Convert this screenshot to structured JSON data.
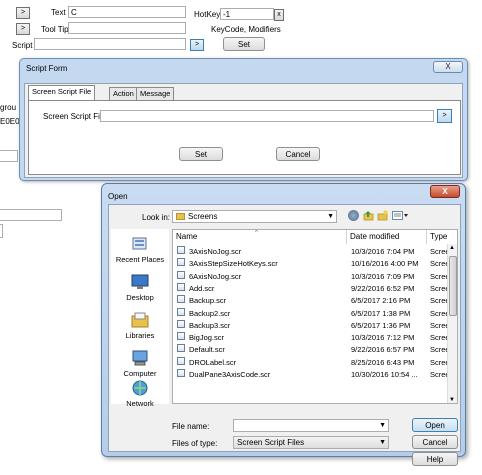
{
  "background_form": {
    "row1_btn": ">",
    "text_label": "Text",
    "text_value": "C",
    "hotkey_label": "HotKey",
    "hotkey_value": "-1",
    "hotkey_clear": "x",
    "row2_btn": ">",
    "tooltip_label": "Tool Tip",
    "keycode_label": "KeyCode, Modifiers",
    "script_label": "Script",
    "script_btn": ">",
    "set_label": "Set",
    "side_text1": "grou",
    "side_text2": "E0E0"
  },
  "script_form": {
    "title": "Script Form",
    "close": "X",
    "tabs": [
      "Screen Script File",
      "Action",
      "Message"
    ],
    "field_label": "Screen Script File",
    "field_value": "",
    "browse_btn": ">",
    "set_label": "Set",
    "cancel_label": "Cancel"
  },
  "open_dialog": {
    "title": "Open",
    "close": "X",
    "look_in_label": "Look in:",
    "look_in_value": "Screens",
    "places": [
      "Recent Places",
      "Desktop",
      "Libraries",
      "Computer",
      "Network"
    ],
    "columns": [
      "Name",
      "Date modified",
      "Type"
    ],
    "files": [
      {
        "name": "3AxisNoJog.scr",
        "date": "10/3/2016 7:04 PM",
        "type": "Screen"
      },
      {
        "name": "3AxisStepSizeHotKeys.scr",
        "date": "10/16/2016 4:00 PM",
        "type": "Screen"
      },
      {
        "name": "6AxisNoJog.scr",
        "date": "10/3/2016 7:09 PM",
        "type": "Screen"
      },
      {
        "name": "Add.scr",
        "date": "9/22/2016 6:52 PM",
        "type": "Screen"
      },
      {
        "name": "Backup.scr",
        "date": "6/5/2017 2:16 PM",
        "type": "Screen"
      },
      {
        "name": "Backup2.scr",
        "date": "6/5/2017 1:38 PM",
        "type": "Screen"
      },
      {
        "name": "Backup3.scr",
        "date": "6/5/2017 1:36 PM",
        "type": "Screen"
      },
      {
        "name": "BigJog.scr",
        "date": "10/3/2016 7:12 PM",
        "type": "Screen"
      },
      {
        "name": "Default.scr",
        "date": "9/22/2016 6:57 PM",
        "type": "Screen"
      },
      {
        "name": "DROLabel.scr",
        "date": "8/25/2016 6:43 PM",
        "type": "Screen"
      },
      {
        "name": "DualPane3AxisCode.scr",
        "date": "10/30/2016 10:54 ...",
        "type": "Screen"
      }
    ],
    "filename_label": "File name:",
    "filename_value": "",
    "filetype_label": "Files of type:",
    "filetype_value": "Screen Script Files",
    "open_label": "Open",
    "cancel_label": "Cancel",
    "help_label": "Help"
  },
  "colors": {
    "window_frame": "#c4d9f0",
    "close_red": "#c64a2e"
  }
}
